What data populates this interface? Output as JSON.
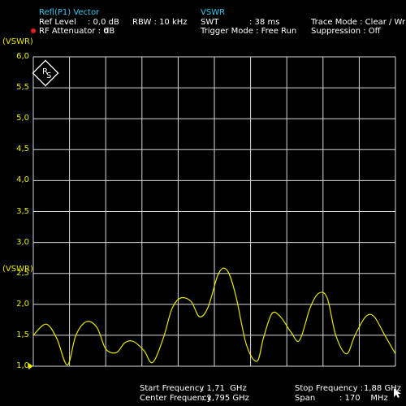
{
  "header": {
    "trace_title": "Refl(P1) Vector",
    "ref_level_label": "Ref Level",
    "ref_level_value": ": 0,0 dB",
    "rbw": "RBW : 10 kHz",
    "rf_atten_label": "RF Attenuator : 0",
    "rf_atten_unit": "dB",
    "mode_title": "VSWR",
    "swt_label": "SWT",
    "swt_value": ": 38 ms",
    "trigger": "Trigger Mode : Free Run",
    "trace_mode": "Trace Mode : Clear / Write",
    "suppression": "Suppression : Off"
  },
  "plot": {
    "unit_label": "(VSWR)",
    "y_ticks": [
      "6,0",
      "5,5",
      "5,0",
      "4,5",
      "4,0",
      "3,5",
      "3,0",
      "2,5",
      "2,0",
      "1,5",
      "1,0"
    ]
  },
  "footer": {
    "start_label": "Start Frequency",
    "start_value": ": 1,71  GHz",
    "center_label": "Center Frequency",
    "center_value": ": 1,795 GHz",
    "stop_label": "Stop Frequency :",
    "stop_value": "1,88 GHz",
    "span_label": "Span",
    "span_value": ": 170    MHz"
  },
  "colors": {
    "trace": "#e8e800",
    "grid": "#d8d8d8",
    "header": "#38c8f0",
    "marker_dot": "#e02020"
  },
  "logo": {
    "letters": "RS"
  },
  "chart_data": {
    "type": "line",
    "x_unit": "GHz",
    "y_unit": "VSWR",
    "ylim": [
      1.0,
      6.0
    ],
    "xlim": [
      1.71,
      1.88
    ],
    "grid": true,
    "series": [
      {
        "x": [
          1.71,
          1.716,
          1.721,
          1.726,
          1.73,
          1.735,
          1.74,
          1.744,
          1.749,
          1.753,
          1.757,
          1.762,
          1.766,
          1.771,
          1.775,
          1.779,
          1.784,
          1.788,
          1.792,
          1.797,
          1.801,
          1.805,
          1.81,
          1.815,
          1.818,
          1.822,
          1.826,
          1.831,
          1.835,
          1.84,
          1.844,
          1.848,
          1.852,
          1.857,
          1.861,
          1.866,
          1.87,
          1.875,
          1.88
        ],
        "y": [
          1.5,
          1.68,
          1.45,
          1.02,
          1.5,
          1.72,
          1.62,
          1.28,
          1.22,
          1.38,
          1.4,
          1.25,
          1.06,
          1.45,
          1.92,
          2.1,
          2.05,
          1.8,
          1.95,
          2.5,
          2.55,
          2.15,
          1.35,
          1.08,
          1.45,
          1.85,
          1.8,
          1.55,
          1.42,
          1.95,
          2.18,
          2.1,
          1.5,
          1.2,
          1.5,
          1.8,
          1.8,
          1.5,
          1.2
        ]
      }
    ]
  }
}
